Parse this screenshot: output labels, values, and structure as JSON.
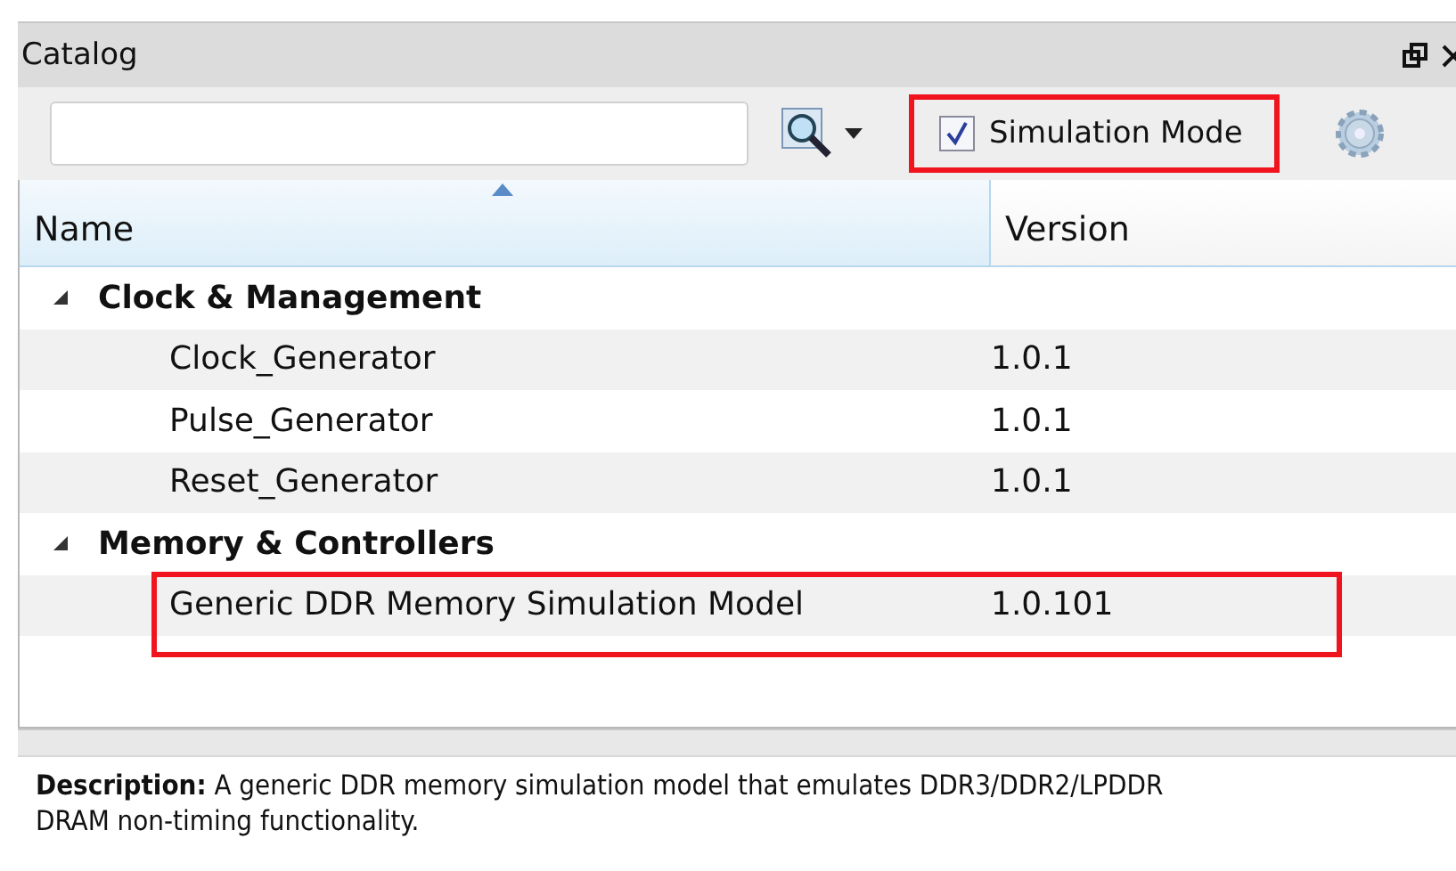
{
  "panel": {
    "title": "Catalog"
  },
  "toolbar": {
    "simulation_mode": {
      "label": "Simulation Mode",
      "checked": true,
      "highlighted": true
    }
  },
  "table": {
    "columns": [
      {
        "label": "Name",
        "sorted": true
      },
      {
        "label": "Version",
        "sorted": false
      }
    ],
    "groups": [
      {
        "name": "Clock & Management",
        "expanded": true,
        "children": [
          {
            "name": "Clock_Generator",
            "version": "1.0.1",
            "highlighted": false
          },
          {
            "name": "Pulse_Generator",
            "version": "1.0.1",
            "highlighted": false
          },
          {
            "name": "Reset_Generator",
            "version": "1.0.1",
            "highlighted": false
          }
        ]
      },
      {
        "name": "Memory & Controllers",
        "expanded": true,
        "children": [
          {
            "name": "Generic DDR Memory Simulation Model",
            "version": "1.0.101",
            "highlighted": true
          }
        ]
      }
    ]
  },
  "description": {
    "text": "**Description:** A generic DDR memory simulation model that emulates DDR3/DDR2/LPDDR DRAM non-timing functionality."
  }
}
